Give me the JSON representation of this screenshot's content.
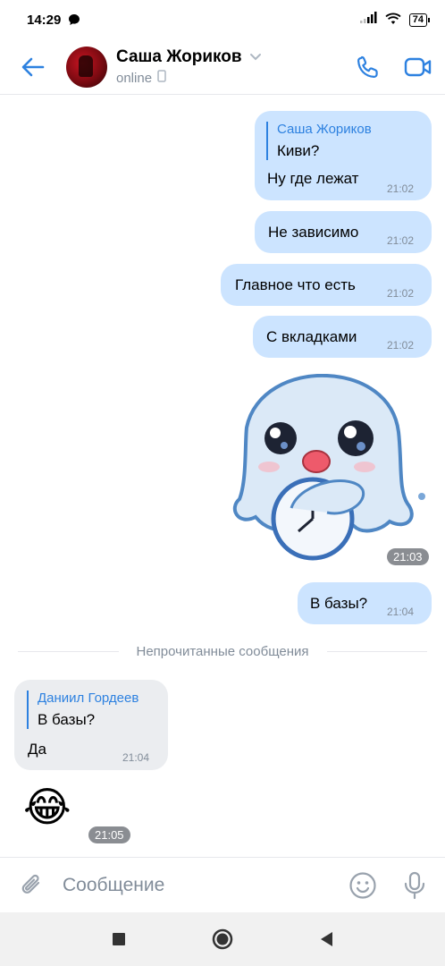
{
  "statusbar": {
    "time": "14:29",
    "battery": "74"
  },
  "header": {
    "contact_name": "Саша Жориков",
    "status": "online"
  },
  "messages": [
    {
      "reply_name": "Саша Жориков",
      "reply_text": "Киви?",
      "text": "Ну где лежат",
      "time": "21:02"
    },
    {
      "text": "Не зависимо",
      "time": "21:02"
    },
    {
      "text": "Главное что есть",
      "time": "21:02"
    },
    {
      "text": "С вкладками",
      "time": "21:02"
    },
    {
      "sticker": "ghost-with-clock-sticker",
      "time": "21:03"
    },
    {
      "text": "В базы?",
      "time": "21:04"
    }
  ],
  "unread_divider": "Непрочитанные сообщения",
  "incoming": [
    {
      "reply_name": "Даниил Гордеев",
      "reply_text": "В базы?",
      "text": "Да",
      "time": "21:04"
    },
    {
      "emoji": "😂",
      "time": "21:05"
    }
  ],
  "composer": {
    "placeholder": "Сообщение"
  },
  "colors": {
    "accent": "#2d81e0",
    "outgoing_bubble": "#cce4ff",
    "incoming_bubble": "#ebedf0",
    "secondary_text": "#818c99"
  }
}
